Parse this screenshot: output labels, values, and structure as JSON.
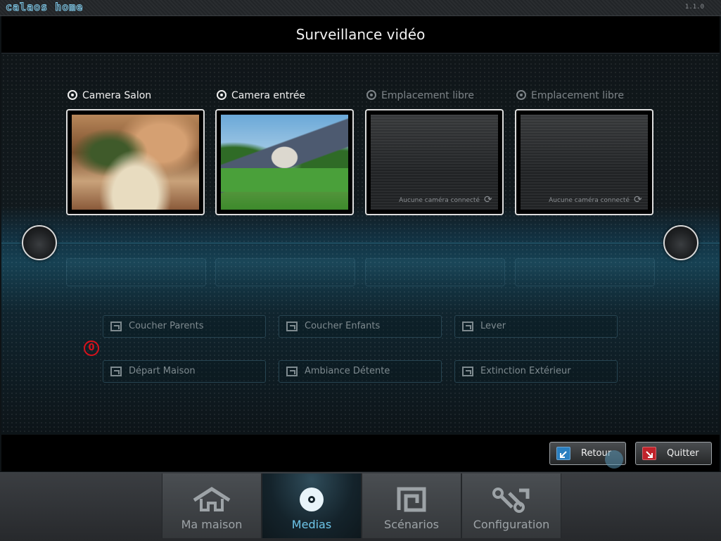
{
  "app": {
    "logo": "calaos home",
    "version": "1.1.0"
  },
  "header": {
    "title": "Surveillance vidéo"
  },
  "cameras": [
    {
      "label": "Camera Salon",
      "state": "active",
      "preview": "living-room"
    },
    {
      "label": "Camera entrée",
      "state": "active",
      "preview": "house-exterior"
    },
    {
      "label": "Emplacement libre",
      "state": "free",
      "empty_text": "Aucune caméra connecté"
    },
    {
      "label": "Emplacement libre",
      "state": "free",
      "empty_text": "Aucune caméra connecté"
    }
  ],
  "scenarios": {
    "counter": "0",
    "items": [
      "Coucher Parents",
      "Coucher Enfants",
      "Lever",
      "Départ Maison",
      "Ambiance Détente",
      "Extinction Extérieur"
    ]
  },
  "actions": {
    "back_label": "Retour",
    "quit_label": "Quitter"
  },
  "tabs": [
    {
      "label": "Ma maison",
      "icon": "house-icon",
      "active": false
    },
    {
      "label": "Medias",
      "icon": "disc-icon",
      "active": true
    },
    {
      "label": "Scénarios",
      "icon": "scenario-icon",
      "active": false
    },
    {
      "label": "Configuration",
      "icon": "tools-icon",
      "active": false
    }
  ],
  "colors": {
    "accent": "#6ec6ea",
    "alert": "#d8121b",
    "back_icon": "#2a7fc0",
    "quit_icon": "#c0232b"
  }
}
